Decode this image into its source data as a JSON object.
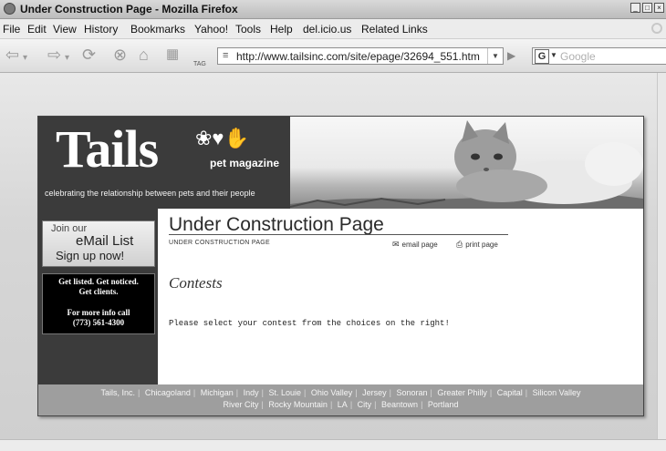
{
  "window": {
    "title": "Under Construction Page - Mozilla Firefox"
  },
  "menu": {
    "items": [
      {
        "label": "File"
      },
      {
        "label": "Edit"
      },
      {
        "label": "View"
      },
      {
        "label": "History"
      },
      {
        "label": "Bookmarks"
      },
      {
        "label": "Yahoo!"
      },
      {
        "label": "Tools"
      },
      {
        "label": "Help"
      },
      {
        "label": "del.icio.us"
      },
      {
        "label": "Related Links"
      }
    ]
  },
  "toolbar": {
    "url": "http://www.tailsinc.com/site/epage/32694_551.htm",
    "search_placeholder": "Google",
    "tag_label": "TAG"
  },
  "site": {
    "logo_text": "Tails",
    "logo_subtitle": "pet magazine",
    "tagline": "celebrating the relationship between pets and their people",
    "signup": {
      "join": "Join our",
      "email": "eMail List",
      "sign": "Sign up now!"
    },
    "promo": {
      "line1": "Get listed. Get noticed.",
      "line2": "Get clients.",
      "line3": "For more info call",
      "phone": "(773) 561-4300"
    },
    "page_title": "Under Construction Page",
    "breadcrumb": "UNDER CONSTRUCTION PAGE",
    "email_page": "email page",
    "print_page": "print page",
    "section_heading": "Contests",
    "body_text": "Please select your contest from the choices on the right!",
    "footer_row1": [
      "Tails, Inc.",
      "Chicagoland",
      "Michigan",
      "Indy",
      "St. Louie",
      "Ohio Valley",
      "Jersey",
      "Sonoran",
      "Greater Philly",
      "Capital",
      "Silicon Valley"
    ],
    "footer_row2": [
      "River City",
      "Rocky Mountain",
      "LA",
      "City",
      "Beantown",
      "Portland"
    ]
  }
}
